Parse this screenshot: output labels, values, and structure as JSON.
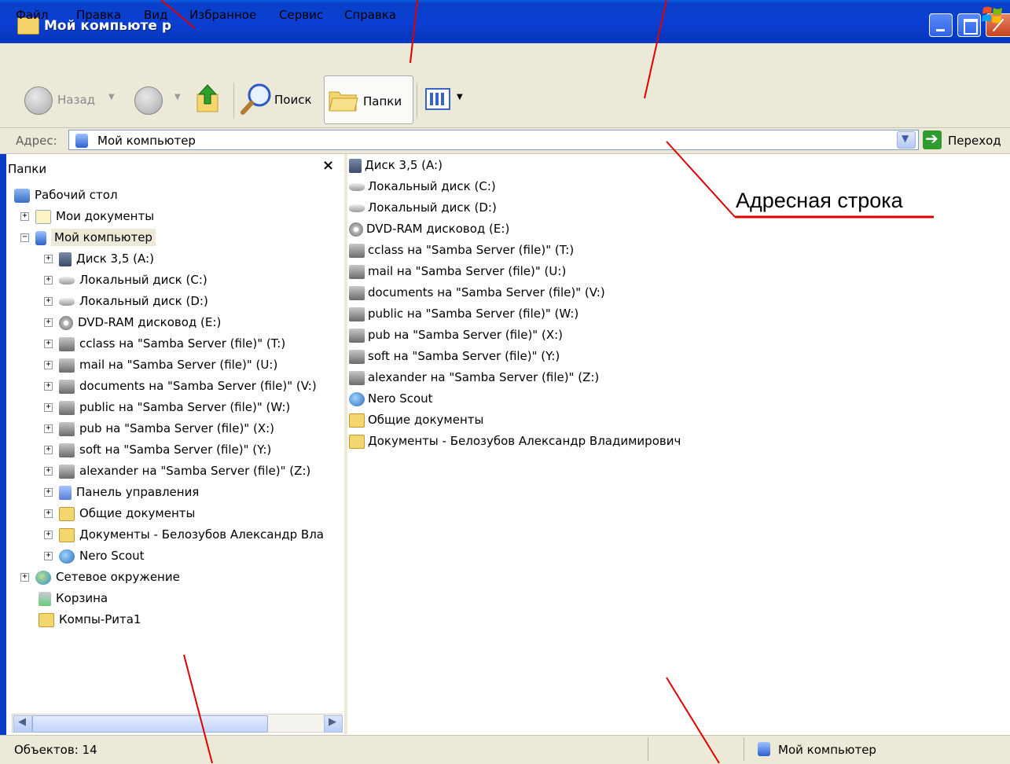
{
  "window": {
    "title": "Мой компьюте р"
  },
  "menu": [
    "Файл",
    "Правка",
    "Вид",
    "Избранное",
    "Сервис",
    "Справка"
  ],
  "toolbar": {
    "back": "Назад",
    "search": "Поиск",
    "folders": "Папки"
  },
  "address": {
    "label": "Адрес:",
    "value": "Мой компьютер",
    "go": "Переход"
  },
  "folder_pane": {
    "title": "Папки",
    "close": "×",
    "tree": [
      {
        "label": "Рабочий стол",
        "icon": "desktop-icon",
        "expander": ""
      },
      {
        "label": "Мои документы",
        "icon": "my-documents-icon",
        "expander": "+"
      },
      {
        "label": "Мой компьютер",
        "icon": "my-computer-icon",
        "expander": "−"
      },
      {
        "label": "Диск 3,5 (A:)",
        "icon": "floppy-drive-icon",
        "expander": "+"
      },
      {
        "label": "Локальный диск (C:)",
        "icon": "hard-drive-icon",
        "expander": "+"
      },
      {
        "label": "Локальный диск (D:)",
        "icon": "hard-drive-icon",
        "expander": "+"
      },
      {
        "label": "DVD-RAM дисковод (E:)",
        "icon": "dvd-drive-icon",
        "expander": "+"
      },
      {
        "label": "cclass на \"Samba Server (file)\" (T:)",
        "icon": "network-drive-icon",
        "expander": "+"
      },
      {
        "label": "mail на \"Samba Server (file)\" (U:)",
        "icon": "network-drive-icon",
        "expander": "+"
      },
      {
        "label": "documents на \"Samba Server (file)\" (V:)",
        "icon": "network-drive-icon",
        "expander": "+"
      },
      {
        "label": "public на \"Samba Server (file)\" (W:)",
        "icon": "network-drive-icon",
        "expander": "+"
      },
      {
        "label": "pub на \"Samba Server (file)\" (X:)",
        "icon": "network-drive-icon",
        "expander": "+"
      },
      {
        "label": "soft на \"Samba Server (file)\" (Y:)",
        "icon": "network-drive-icon",
        "expander": "+"
      },
      {
        "label": "alexander на \"Samba Server (file)\" (Z:)",
        "icon": "network-drive-icon",
        "expander": "+"
      },
      {
        "label": "Панель управления",
        "icon": "control-panel-icon",
        "expander": "+"
      },
      {
        "label": "Общие документы",
        "icon": "folder-icon",
        "expander": "+"
      },
      {
        "label": "Документы - Белозубов Александр Вла",
        "icon": "folder-icon",
        "expander": "+"
      },
      {
        "label": "Nero Scout",
        "icon": "nero-scout-icon",
        "expander": "+"
      },
      {
        "label": "Сетевое окружение",
        "icon": "network-places-icon",
        "expander": "+"
      },
      {
        "label": "Корзина",
        "icon": "recycle-bin-icon",
        "expander": ""
      },
      {
        "label": "Компы-Рита1",
        "icon": "folder-icon",
        "expander": ""
      }
    ]
  },
  "content": {
    "items": [
      {
        "label": "Диск 3,5 (A:)",
        "icon": "floppy-drive-icon"
      },
      {
        "label": "Локальный диск (C:)",
        "icon": "hard-drive-icon"
      },
      {
        "label": "Локальный диск (D:)",
        "icon": "hard-drive-icon"
      },
      {
        "label": "DVD-RAM дисковод (E:)",
        "icon": "dvd-drive-icon"
      },
      {
        "label": "cclass на \"Samba Server (file)\" (T:)",
        "icon": "network-drive-icon"
      },
      {
        "label": "mail на \"Samba Server (file)\" (U:)",
        "icon": "network-drive-icon"
      },
      {
        "label": "documents на \"Samba Server (file)\" (V:)",
        "icon": "network-drive-icon"
      },
      {
        "label": "public на \"Samba Server (file)\" (W:)",
        "icon": "network-drive-icon"
      },
      {
        "label": "pub на \"Samba Server (file)\" (X:)",
        "icon": "network-drive-icon"
      },
      {
        "label": "soft на \"Samba Server (file)\" (Y:)",
        "icon": "network-drive-icon"
      },
      {
        "label": "alexander на \"Samba Server (file)\" (Z:)",
        "icon": "network-drive-icon"
      },
      {
        "label": "Nero Scout",
        "icon": "nero-scout-icon"
      },
      {
        "label": "Общие документы",
        "icon": "folder-icon"
      },
      {
        "label": "Документы - Белозубов Александр Владимирович",
        "icon": "folder-icon"
      }
    ]
  },
  "status": {
    "left": "Объектов: 14",
    "right": "Мой компьютер"
  },
  "annotation": {
    "label": "Адресная строка",
    "color": "#e00000"
  }
}
